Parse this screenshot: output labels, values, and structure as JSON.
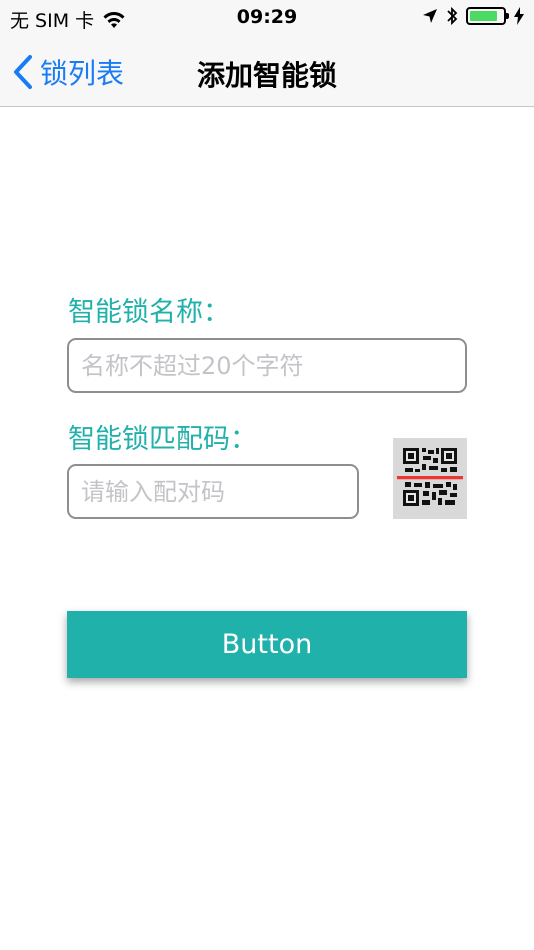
{
  "status_bar": {
    "carrier": "无 SIM 卡",
    "time": "09:29",
    "battery_level": 0.85,
    "battery_color": "#4cd964"
  },
  "nav_bar": {
    "back_label": "锁列表",
    "title": "添加智能锁",
    "accent_color": "#1a7cf5"
  },
  "form": {
    "name_label": "智能锁名称：",
    "name_placeholder": "名称不超过20个字符",
    "name_value": "",
    "code_label": "智能锁匹配码：",
    "code_placeholder": "请输入配对码",
    "code_value": "",
    "scan_icon": "qr-code-scan-icon",
    "label_color": "#20b2aa"
  },
  "submit": {
    "label": "Button",
    "color": "#20b2aa"
  }
}
